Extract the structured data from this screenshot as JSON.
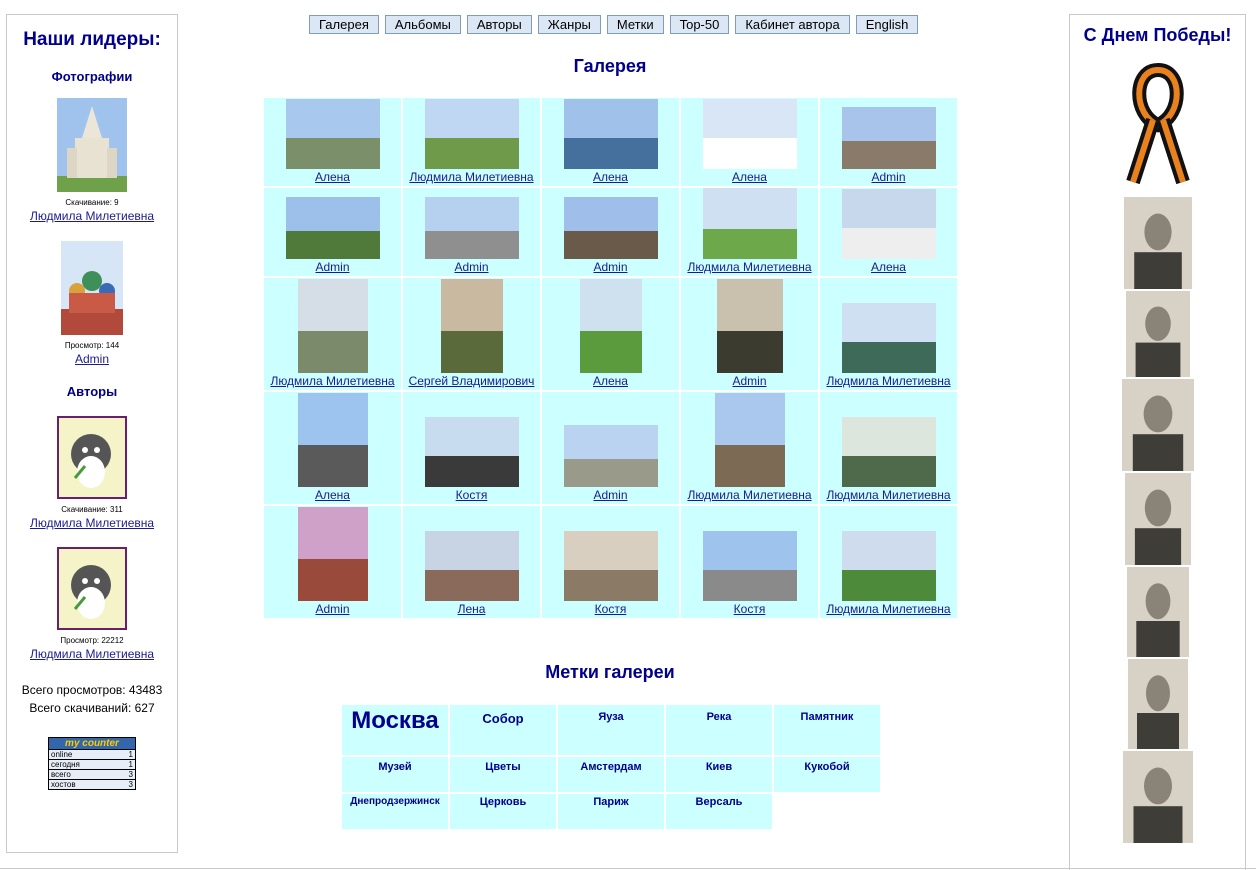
{
  "nav": [
    "Галерея",
    "Альбомы",
    "Авторы",
    "Жанры",
    "Метки",
    "Top-50",
    "Кабинет автора",
    "English"
  ],
  "gallery_title": "Галерея",
  "tags_title": "Метки галереи",
  "left": {
    "title": "Наши лидеры:",
    "photos_heading": "Фотографии",
    "photo1_stat": "Скачивание: 9",
    "photo1_author": "Людмила Милетиевна",
    "photo2_stat": "Просмотр: 144",
    "photo2_author": "Admin",
    "authors_heading": "Авторы",
    "author1_stat": "Скачивание: 311",
    "author1_name": "Людмила Милетиевна",
    "author2_stat": "Просмотр: 22212",
    "author2_name": "Людмила Милетиевна",
    "total_views": "Всего просмотров: 43483",
    "total_downloads": "Всего скачиваний: 627",
    "counter": {
      "header": "my counter",
      "rows": [
        {
          "label": "online",
          "value": "1"
        },
        {
          "label": "сегодня",
          "value": "1"
        },
        {
          "label": "всего",
          "value": "3"
        },
        {
          "label": "хостов",
          "value": "3"
        }
      ]
    }
  },
  "right": {
    "title": "С Днем Победы!"
  },
  "grid": [
    [
      "Алена",
      "Людмила Милетиевна",
      "Алена",
      "Алена",
      "Admin"
    ],
    [
      "Admin",
      "Admin",
      "Admin",
      "Людмила Милетиевна",
      "Алена"
    ],
    [
      "Людмила Милетиевна",
      "Сергей Владимирович",
      "Алена",
      "Admin",
      "Людмила Милетиевна"
    ],
    [
      "Алена",
      "Костя",
      "Admin",
      "Людмила Милетиевна",
      "Людмила Милетиевна"
    ],
    [
      "Admin",
      "Лена",
      "Костя",
      "Костя",
      "Людмила Милетиевна"
    ]
  ],
  "tags": [
    "Москва",
    "Собор",
    "Яуза",
    "Река",
    "Памятник",
    "Музей",
    "Цветы",
    "Амстердам",
    "Киев",
    "Кукобой",
    "Днепродзержинск",
    "Церковь",
    "Париж",
    "Версаль"
  ]
}
